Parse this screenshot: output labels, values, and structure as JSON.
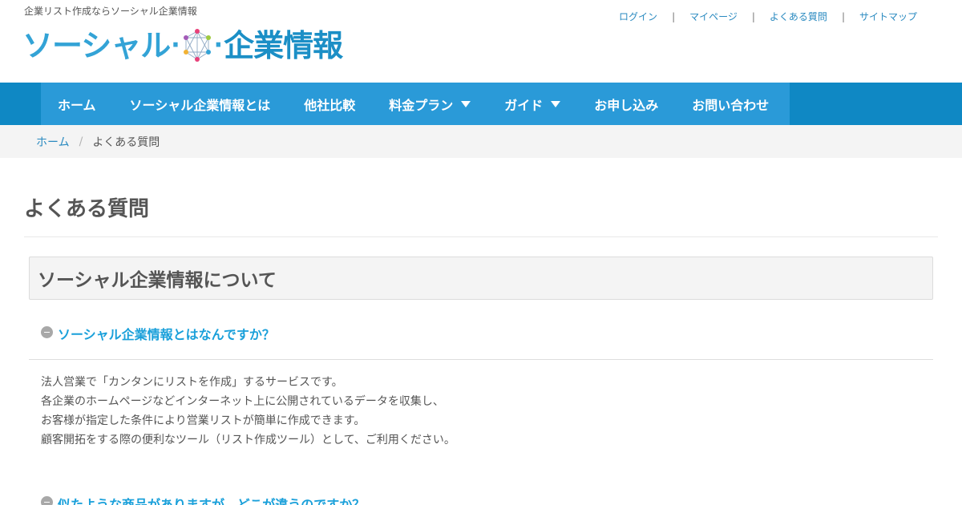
{
  "header": {
    "tagline": "企業リスト作成ならソーシャル企業情報",
    "logo": {
      "part1": "ソーシャル",
      "separator_left": "·",
      "separator_right": "·",
      "part2": "企業情報"
    },
    "top_links": [
      {
        "label": "ログイン"
      },
      {
        "label": "マイページ"
      },
      {
        "label": "よくある質問"
      },
      {
        "label": "サイトマップ"
      }
    ],
    "top_link_separator": "|"
  },
  "nav": {
    "items": [
      {
        "label": "ホーム",
        "dropdown": false
      },
      {
        "label": "ソーシャル企業情報とは",
        "dropdown": false
      },
      {
        "label": "他社比較",
        "dropdown": false
      },
      {
        "label": "料金プラン",
        "dropdown": true
      },
      {
        "label": "ガイド",
        "dropdown": true
      },
      {
        "label": "お申し込み",
        "dropdown": false
      },
      {
        "label": "お問い合わせ",
        "dropdown": false
      }
    ]
  },
  "breadcrumb": {
    "home": "ホーム",
    "separator": "/",
    "current": "よくある質問"
  },
  "main": {
    "title": "よくある質問",
    "section_title": "ソーシャル企業情報について",
    "faqs": [
      {
        "question": "ソーシャル企業情報とはなんですか？",
        "answer_lines": [
          "法人営業で「カンタンにリストを作成」するサービスです。",
          "各企業のホームページなどインターネット上に公開されているデータを収集し、",
          "お客様が指定した条件により営業リストが簡単に作成できます。",
          "顧客開拓をする際の便利なツール（リスト作成ツール）として、ご利用ください。"
        ]
      },
      {
        "question": "似たような商品がありますが、どこが違うのですか？"
      }
    ]
  },
  "colors": {
    "nav_outer": "#0f88c4",
    "nav_inner": "#2a9ad8",
    "link": "#2a8ac0",
    "faq_question": "#1aa0da",
    "logo_light": "#33a3d6",
    "logo_dark": "#1b8fc6"
  },
  "icons": {
    "logo_mark": "network-molecule-icon",
    "faq_toggle": "minus-circle-icon",
    "dropdown": "caret-down-icon"
  }
}
